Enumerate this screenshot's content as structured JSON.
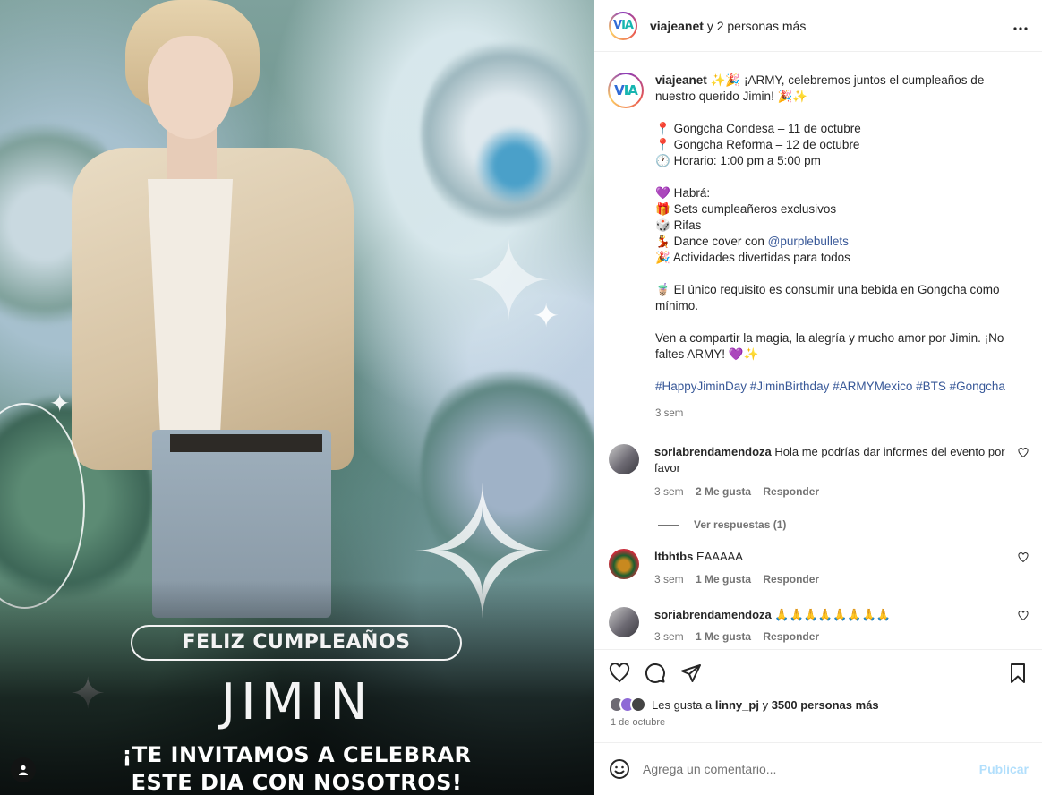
{
  "media": {
    "pill_text": "FELIZ CUMPLEAÑOS",
    "name_text": "JIMIN",
    "invite_line1": "¡TE INVITAMOS A CELEBRAR",
    "invite_line2": "ESTE DIA CON NOSOTROS!"
  },
  "header": {
    "username": "viajeanet",
    "others": " y 2 personas más",
    "logo_v": "V",
    "logo_ia": "IA",
    "more_icon": "more-horizontal-icon"
  },
  "caption": {
    "username": "viajeanet",
    "emojis_before": "✨🎉",
    "intro": " ¡ARMY, celebremos juntos el cumpleaños de nuestro querido Jimin! ",
    "emojis_after": "🎉✨",
    "loc1_icon": "📍",
    "loc1": " Gongcha Condesa – 11 de octubre",
    "loc2_icon": "📍",
    "loc2": " Gongcha Reforma – 12 de octubre",
    "time_icon": "🕐",
    "time": " Horario: 1:00 pm a 5:00 pm",
    "habra_icon": "💜",
    "habra": " Habrá:",
    "item1_icon": "🎁",
    "item1": " Sets cumpleañeros exclusivos",
    "item2_icon": "🎲",
    "item2": " Rifas",
    "item3_icon": "💃",
    "item3": " Dance cover con ",
    "item3_mention": "@purplebullets",
    "item4_icon": "🎉",
    "item4": " Actividades divertidas para todos",
    "req_icon": "🧋",
    "requirement": " El único requisito es consumir una bebida en Gongcha como mínimo.",
    "closing": "Ven a compartir la magia, la alegría y mucho amor por Jimin. ¡No faltes ARMY! ",
    "closing_emojis": "💜✨",
    "hashtags": "#HappyJiminDay #JiminBirthday #ARMYMexico #BTS #Gongcha",
    "time_ago": "3 sem"
  },
  "comments": [
    {
      "username": "soriabrendamendoza",
      "text": " Hola me podrías dar informes del evento por favor",
      "time": "3 sem",
      "likes": "2 Me gusta",
      "reply": "Responder",
      "view_replies": "Ver respuestas (1)"
    },
    {
      "username": "ltbhtbs",
      "text": " EAAAAA",
      "time": "3 sem",
      "likes": "1 Me gusta",
      "reply": "Responder"
    },
    {
      "username": "soriabrendamendoza",
      "text": " 🙏🙏🙏🙏🙏🙏🙏🙏",
      "time": "3 sem",
      "likes": "1 Me gusta",
      "reply": "Responder"
    }
  ],
  "actions": {
    "likes_prefix": "Les gusta a ",
    "likes_user": "linny_pj",
    "likes_mid": " y ",
    "likes_count": "3500 personas más",
    "date": "1 de octubre"
  },
  "add_comment": {
    "placeholder": "Agrega un comentario...",
    "publish": "Publicar"
  },
  "colors": {
    "link": "#385898",
    "publish_disabled": "#b2dffc",
    "muted": "#737373"
  }
}
